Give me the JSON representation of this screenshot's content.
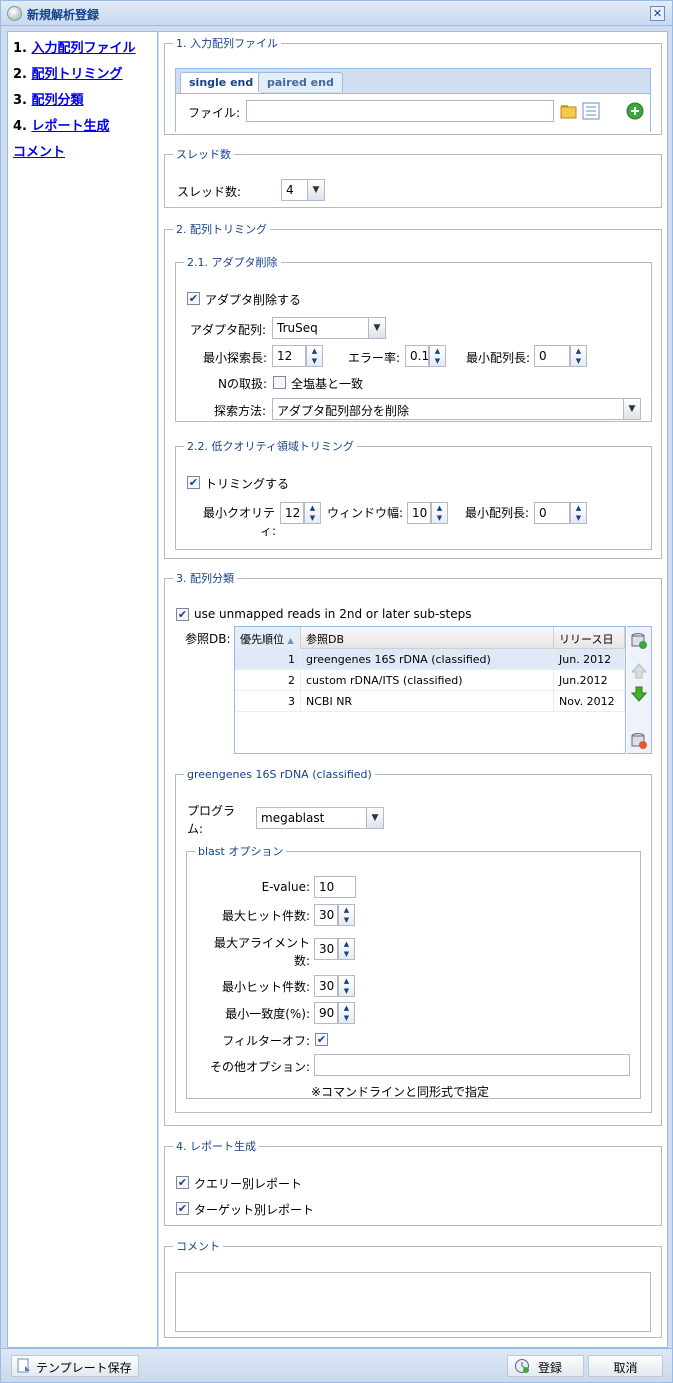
{
  "window": {
    "title": "新規解析登録",
    "close_label": "✕"
  },
  "nav": {
    "items": [
      {
        "num": "1.",
        "label": "入力配列ファイル"
      },
      {
        "num": "2.",
        "label": "配列トリミング"
      },
      {
        "num": "3.",
        "label": "配列分類"
      },
      {
        "num": "4.",
        "label": "レポート生成"
      },
      {
        "num": "",
        "label": "コメント"
      }
    ]
  },
  "input_file": {
    "legend": "1. 入力配列ファイル",
    "tabs": [
      "single end",
      "paired end"
    ],
    "active_tab": "single end",
    "file_label": "ファイル:",
    "file_value": ""
  },
  "threads": {
    "legend": "スレッド数",
    "label": "スレッド数:",
    "value": "4"
  },
  "trimming": {
    "legend": "2. 配列トリミング",
    "adapter": {
      "legend": "2.1. アダプタ削除",
      "enable_label": "アダプタ削除する",
      "enabled": true,
      "seq_label": "アダプタ配列:",
      "seq_value": "TruSeq",
      "min_search_label": "最小探索長:",
      "min_search_value": "12",
      "error_label": "エラー率:",
      "error_value": "0.1",
      "min_len_label": "最小配列長:",
      "min_len_value": "0",
      "n_label": "Nの取扱:",
      "n_option_label": "全塩基と一致",
      "n_option_checked": false,
      "method_label": "探索方法:",
      "method_value": "アダプタ配列部分を削除"
    },
    "quality": {
      "legend": "2.2. 低クオリティ領域トリミング",
      "enable_label": "トリミングする",
      "enabled": true,
      "min_quality_label_1": "最小クオリテ",
      "min_quality_label_2": "ィ:",
      "min_quality_value": "12",
      "window_label": "ウィンドウ幅:",
      "window_value": "10",
      "min_len_label": "最小配列長:",
      "min_len_value": "0"
    }
  },
  "classification": {
    "legend": "3. 配列分類",
    "unmapped_label": "use unmapped reads in 2nd or later sub-steps",
    "unmapped_checked": true,
    "refdb_label": "参照DB:",
    "columns": [
      "優先順位",
      "参照DB",
      "リリース日"
    ],
    "rows": [
      {
        "priority": "1",
        "db": "greengenes 16S rDNA (classified)",
        "date": "Jun. 2012"
      },
      {
        "priority": "2",
        "db": "custom rDNA/ITS (classified)",
        "date": "Jun.2012"
      },
      {
        "priority": "3",
        "db": "NCBI NR",
        "date": "Nov. 2012"
      }
    ],
    "selected_db": {
      "legend": "greengenes 16S rDNA (classified)",
      "program_label_1": "プログラ",
      "program_label_2": "ム:",
      "program_value": "megablast",
      "blast": {
        "legend": "blast オプション",
        "evalue_label": "E-value:",
        "evalue_value": "10",
        "max_hits_label": "最大ヒット件数:",
        "max_hits_value": "30",
        "max_align_label_1": "最大アライメント",
        "max_align_label_2": "数:",
        "max_align_value": "30",
        "min_hits_label": "最小ヒット件数:",
        "min_hits_value": "30",
        "min_identity_label": "最小一致度(%):",
        "min_identity_value": "90",
        "filter_off_label": "フィルターオフ:",
        "filter_off_checked": true,
        "other_label": "その他オプション:",
        "other_value": "",
        "note": "※コマンドラインと同形式で指定"
      }
    }
  },
  "report": {
    "legend": "4. レポート生成",
    "query_label": "クエリー別レポート",
    "query_checked": true,
    "target_label": "ターゲット別レポート",
    "target_checked": true
  },
  "comment": {
    "legend": "コメント",
    "value": ""
  },
  "footer": {
    "template_save": "テンプレート保存",
    "register": "登録",
    "cancel": "取消"
  },
  "colors": {
    "accent": "#15428b",
    "border": "#99bbe8",
    "panel_bg": "#cfdcee"
  }
}
